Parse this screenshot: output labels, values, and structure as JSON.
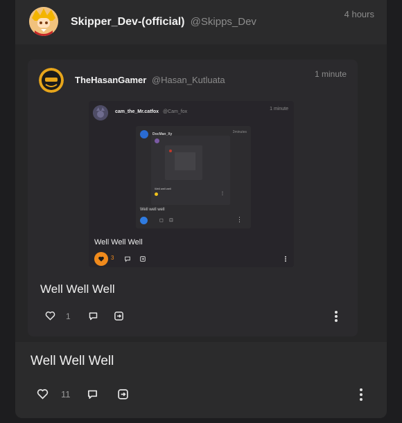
{
  "outer": {
    "author_name": "Skipper_Dev-(official)",
    "author_handle": "@Skipps_Dev",
    "time": "4 hours",
    "text": "Well Well Well",
    "like_count": "11"
  },
  "quoted": {
    "author_name": "TheHasanGamer",
    "author_handle": "@Hasan_Kutluata",
    "time": "1 minute",
    "text": "Well Well Well",
    "like_count": "1"
  },
  "nested": {
    "author_name": "cam_the_Mr.catfox",
    "author_handle": "@Cam_fox",
    "time": "1 minute",
    "text": "Well Well Well",
    "like_count": "3"
  },
  "deep": {
    "author_name": "DocMan_Xy",
    "time": "2minutes",
    "text": "Well well well"
  },
  "deeper": {
    "text": "Well well well"
  },
  "icons": {
    "like": "heart-icon",
    "reply": "comment-icon",
    "share": "share-icon",
    "more": "more-vertical-icon"
  },
  "colors": {
    "like_active": "#f08a1c"
  }
}
